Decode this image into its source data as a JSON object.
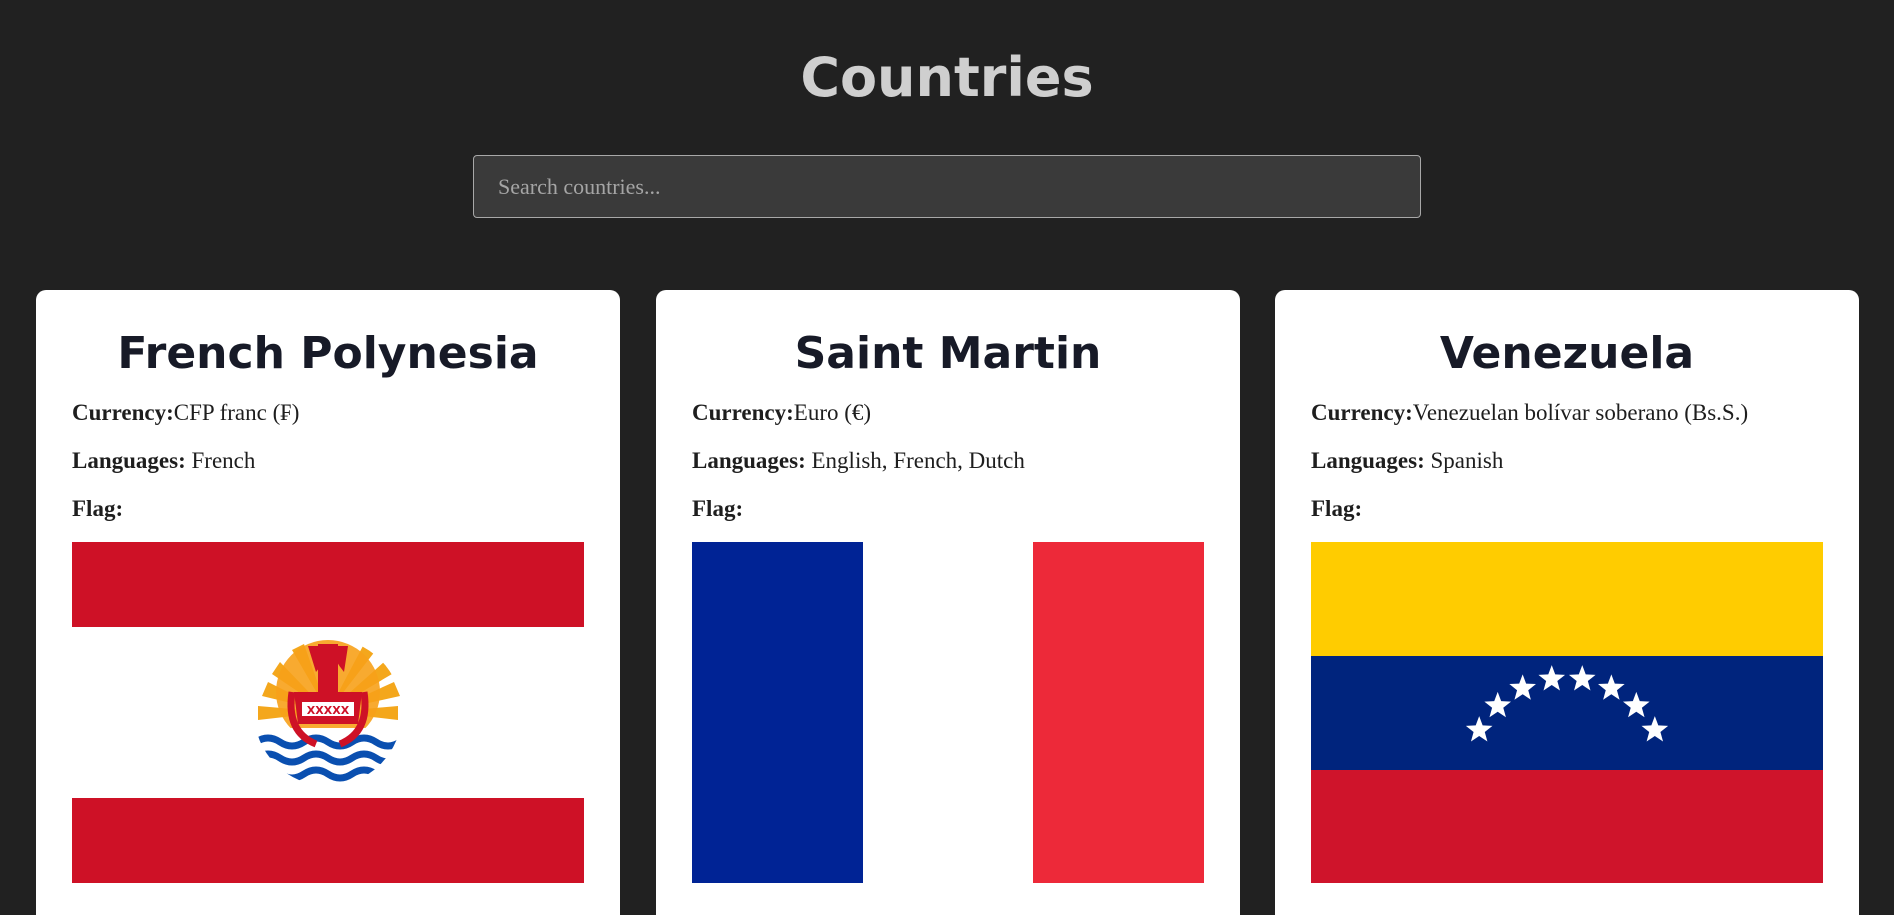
{
  "header": {
    "title": "Countries"
  },
  "search": {
    "placeholder": "Search countries...",
    "value": ""
  },
  "labels": {
    "currency": "Currency:",
    "languages": "Languages:",
    "flag": "Flag:"
  },
  "countries": [
    {
      "name": "French Polynesia",
      "currency": "CFP franc (₣)",
      "languages": "French",
      "flag_icon": "french-polynesia-flag",
      "flag_colors": [
        "#ce1126",
        "#ffffff",
        "#ce1126"
      ],
      "emblem_text": "XXXXX"
    },
    {
      "name": "Saint Martin",
      "currency": "Euro (€)",
      "languages": "English, French, Dutch",
      "flag_icon": "saint-martin-flag",
      "flag_colors": [
        "#002395",
        "#ffffff",
        "#ed2939"
      ]
    },
    {
      "name": "Venezuela",
      "currency": "Venezuelan bolívar soberano (Bs.S.)",
      "languages": "Spanish",
      "flag_icon": "venezuela-flag",
      "flag_colors": [
        "#ffcc00",
        "#00247d",
        "#cf142b"
      ]
    }
  ]
}
